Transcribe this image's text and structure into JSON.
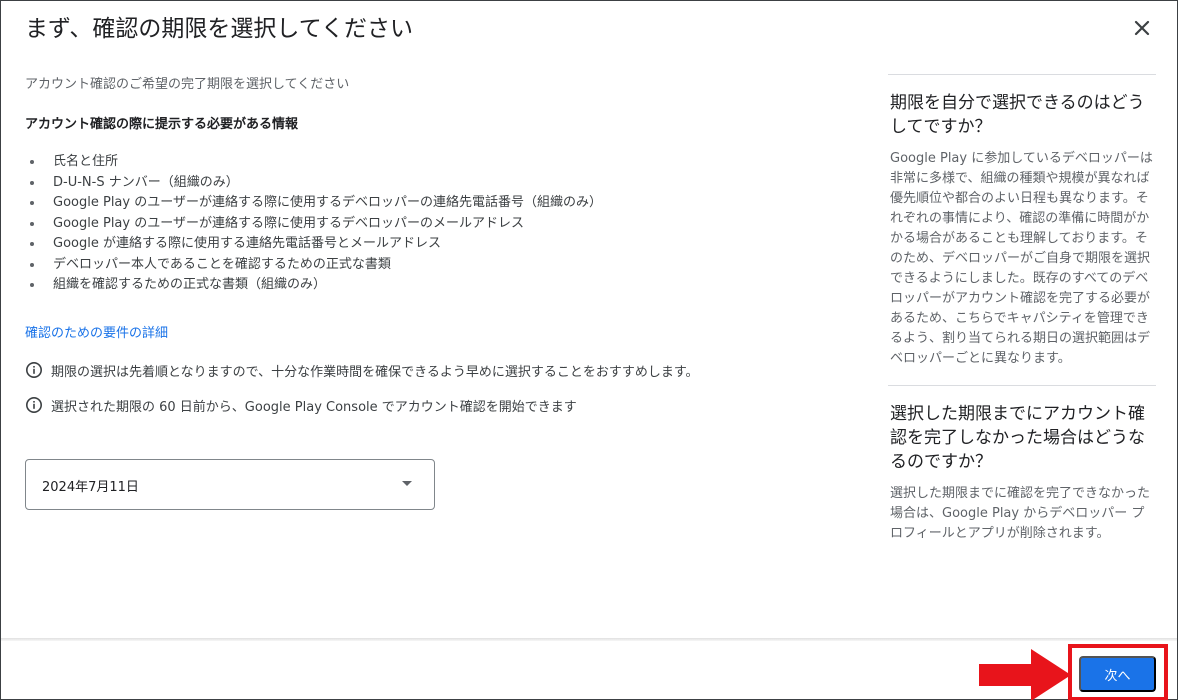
{
  "dialog": {
    "title": "まず、確認の期限を選択してください",
    "close_icon": "close-icon"
  },
  "main": {
    "subtitle": "アカウント確認のご希望の完了期限を選択してください",
    "requirements_heading": "アカウント確認の際に提示する必要がある情報",
    "requirements": [
      "氏名と住所",
      "D-U-N-S ナンバー（組織のみ）",
      "Google Play のユーザーが連絡する際に使用するデベロッパーの連絡先電話番号（組織のみ）",
      "Google Play のユーザーが連絡する際に使用するデベロッパーのメールアドレス",
      "Google が連絡する際に使用する連絡先電話番号とメールアドレス",
      "デベロッパー本人であることを確認するための正式な書類",
      "組織を確認するための正式な書類（組織のみ）"
    ],
    "details_link": "確認のための要件の詳細",
    "notes": [
      "期限の選択は先着順となりますので、十分な作業時間を確保できるよう早めに選択することをおすすめします。",
      "選択された期限の 60 日前から、Google Play Console でアカウント確認を開始できます"
    ],
    "date_select": {
      "value": "2024年7月11日"
    }
  },
  "aside": {
    "sections": [
      {
        "heading": "期限を自分で選択できるのはどうしてですか？",
        "body": "Google Play に参加しているデベロッパーは非常に多様で、組織の種類や規模が異なれば優先順位や都合のよい日程も異なります。それぞれの事情により、確認の準備に時間がかかる場合があることも理解しております。そのため、デベロッパーがご自身で期限を選択できるようにしました。既存のすべてのデベロッパーがアカウント確認を完了する必要があるため、こちらでキャパシティを管理できるよう、割り当てられる期日の選択範囲はデベロッパーごとに異なります。"
      },
      {
        "heading": "選択した期限までにアカウント確認を完了しなかった場合はどうなるのですか？",
        "body": "選択した期限までに確認を完了できなかった場合は、Google Play からデベロッパー プロフィールとアプリが削除されます。"
      }
    ]
  },
  "footer": {
    "next_label": "次へ"
  },
  "colors": {
    "accent": "#1a73e8",
    "highlight": "#e8141b"
  }
}
